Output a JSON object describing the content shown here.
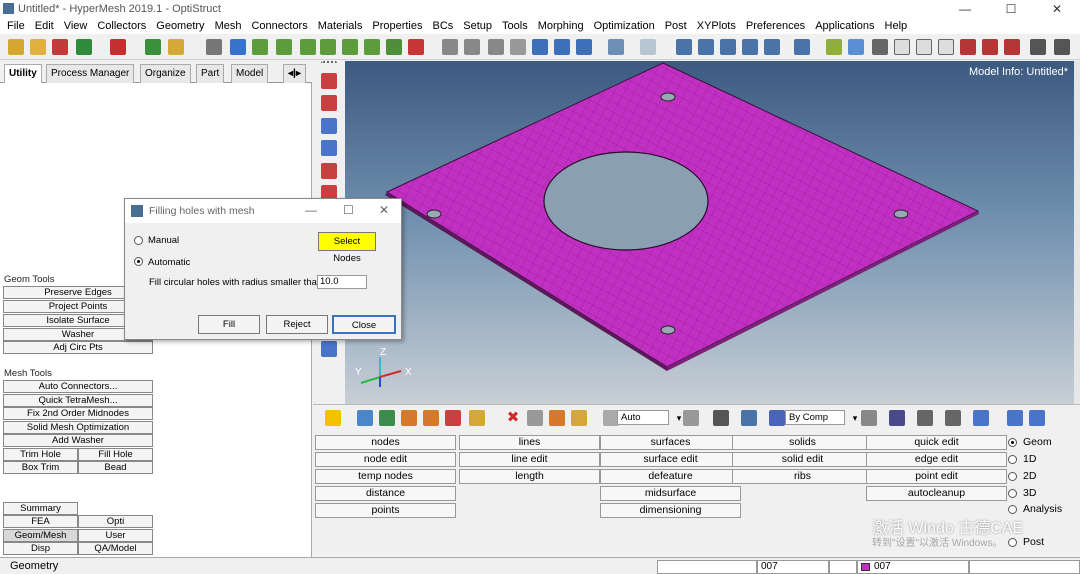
{
  "window": {
    "title": "Untitled* - HyperMesh 2019.1 - OptiStruct",
    "min": "—",
    "max": "☐",
    "close": "✕"
  },
  "menu": [
    "File",
    "Edit",
    "View",
    "Collectors",
    "Geometry",
    "Mesh",
    "Connectors",
    "Materials",
    "Properties",
    "BCs",
    "Setup",
    "Tools",
    "Morphing",
    "Optimization",
    "Post",
    "XYPlots",
    "Preferences",
    "Applications",
    "Help"
  ],
  "tabs": [
    "Utility",
    "Process Manager",
    "Organize",
    "Part",
    "Model"
  ],
  "left_panel": {
    "geom_tools_label": "Geom Tools",
    "geom_tools": [
      "Preserve Edges",
      "Project Points",
      "Isolate Surface",
      "Washer",
      "Adj Circ Pts"
    ],
    "mesh_tools_label": "Mesh Tools",
    "mesh_tools": [
      "Auto Connectors...",
      "Quick TetraMesh...",
      "Fix 2nd Order Midnodes",
      "Solid Mesh Optimization",
      "Add Washer"
    ],
    "mesh_pairs": [
      [
        "Trim Hole",
        "Fill Hole"
      ],
      [
        "Box Trim",
        "Bead"
      ]
    ],
    "bottom": {
      "summary": "Summary",
      "fea": "FEA",
      "opti": "Opti",
      "geom_mesh": "Geom/Mesh",
      "user": "User",
      "disp": "Disp",
      "qa_model": "QA/Model"
    }
  },
  "viewport": {
    "model_info": "Model Info: Untitled*",
    "axes": {
      "z": "Z",
      "y": "Y",
      "x": "X"
    }
  },
  "dialog": {
    "title": "Filling holes with mesh",
    "manual": "Manual",
    "select_nodes": "Select Nodes",
    "automatic": "Automatic",
    "radius_label": "Fill circular holes with radius smaller than:",
    "radius_value": "10.0",
    "fill": "Fill",
    "reject": "Reject",
    "close": "Close"
  },
  "lower_toolbar": {
    "auto": "Auto",
    "bycomp": "By Comp"
  },
  "panel_grid": [
    [
      "nodes",
      "lines",
      "surfaces",
      "solids",
      "quick edit"
    ],
    [
      "node edit",
      "line edit",
      "surface edit",
      "solid edit",
      "edge edit"
    ],
    [
      "temp nodes",
      "length",
      "defeature",
      "ribs",
      "point edit"
    ],
    [
      "distance",
      "",
      "midsurface",
      "",
      "autocleanup"
    ],
    [
      "points",
      "",
      "dimensioning",
      "",
      ""
    ]
  ],
  "page_radios": [
    "Geom",
    "1D",
    "2D",
    "3D",
    "Analysis",
    "Post"
  ],
  "status": {
    "left": "Geometry",
    "comp1": "007",
    "comp2": "007"
  },
  "watermark": {
    "line1": "激活 Windo 古德CAE",
    "line2": "转到\"设置\"以激活 Windows。"
  },
  "colors": {
    "mesh": "#c22fc3",
    "accent": "#ffff00"
  }
}
